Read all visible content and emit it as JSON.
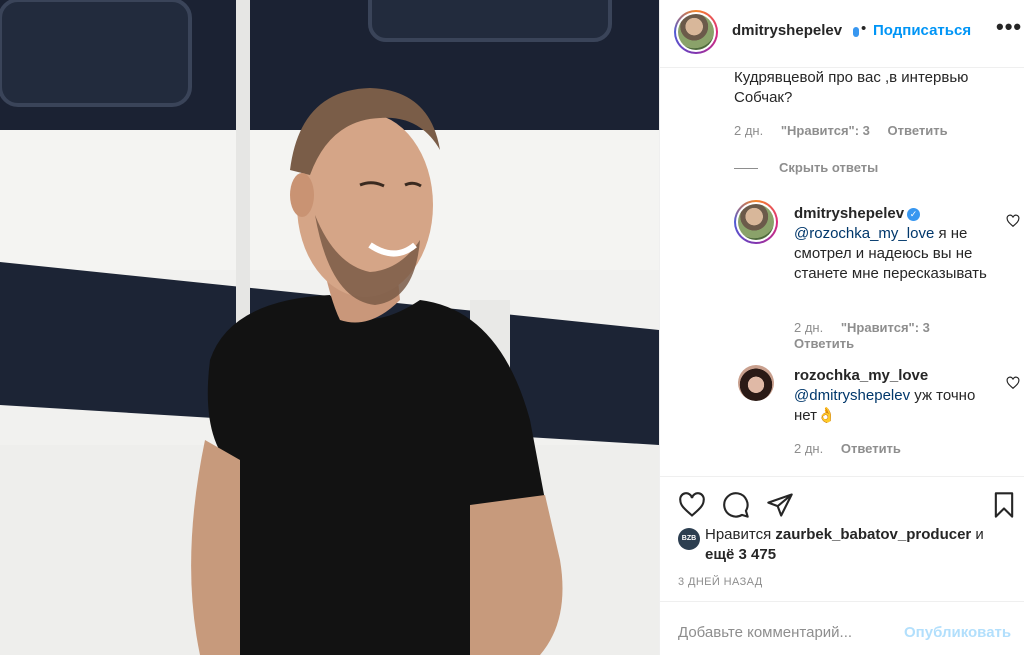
{
  "post": {
    "author": "dmitryshepelev",
    "separator": "•",
    "follow_label": "Подписаться",
    "more_label": "•••"
  },
  "comment1": {
    "text": "Кудрявцевой про вас ,в интервью Собчак?",
    "time": "2 дн.",
    "likes": "\"Нравится\": 3",
    "reply_label": "Ответить"
  },
  "hide_replies_label": "Скрыть ответы",
  "reply1": {
    "username": "dmitryshepelev",
    "verified_icon": "✓",
    "mention": "@rozochka_my_love",
    "text": " я не смотрел и надеюсь вы не станете мне пересказывать",
    "time": "2 дн.",
    "likes": "\"Нравится\": 3",
    "reply_label": "Ответить"
  },
  "reply2": {
    "username": "rozochka_my_love",
    "mention": "@dmitryshepelev",
    "text": " уж точно нет👌",
    "time": "2 дн.",
    "reply_label": "Ответить"
  },
  "likes_row": {
    "avatar_text": "BZB",
    "prefix": "Нравится ",
    "user": "zaurbek_babatov_producer",
    "middle": " и ",
    "others": "ещё 3 475"
  },
  "timestamp": "3 ДНЕЙ НАЗАД",
  "add_comment": {
    "placeholder": "Добавьте комментарий...",
    "post_label": "Опубликовать"
  },
  "icons": {
    "like": "heart-icon",
    "comment": "comment-icon",
    "share": "paper-plane-icon",
    "save": "bookmark-icon"
  },
  "colors": {
    "link_blue": "#0095f6",
    "post_disabled": "#b2dffc",
    "secondary_text": "#8e8e8e",
    "mention": "#00376b"
  }
}
